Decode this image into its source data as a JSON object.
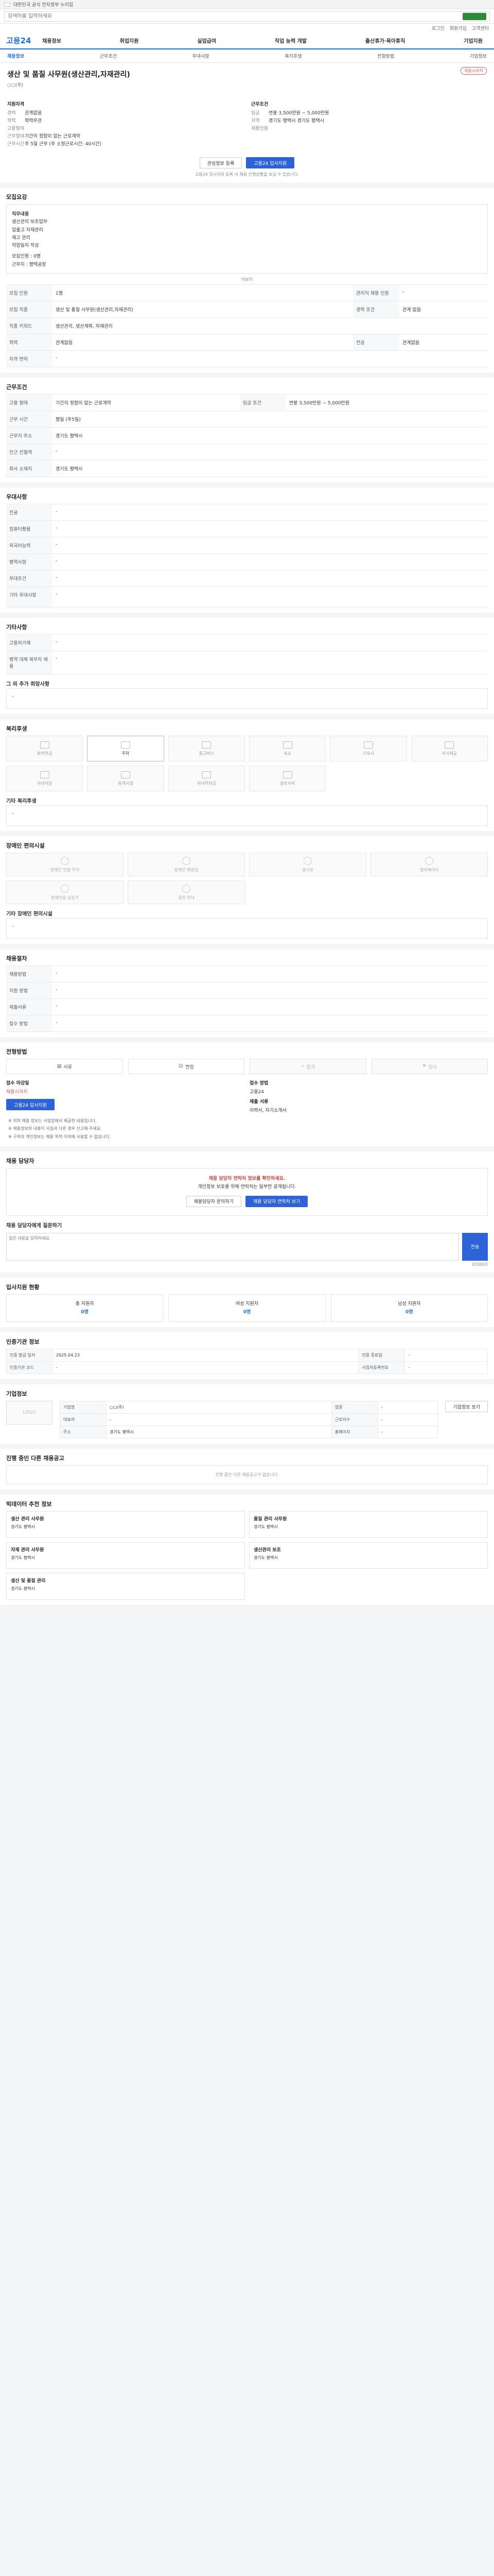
{
  "topstrip": {
    "text": "대한민국 공식 전자정부 누리집"
  },
  "search": {
    "placeholder": "검색어를 입력하세요"
  },
  "util": [
    "로그인",
    "회원가입",
    "고객센터"
  ],
  "gnb": {
    "logo": "고용24",
    "menu": [
      "채용정보",
      "취업지원",
      "실업급여",
      "직업 능력 개발",
      "출산휴가·육아휴직",
      "기업지원"
    ]
  },
  "tabs": [
    "채용정보",
    "근무조건",
    "우대사항",
    "복리후생",
    "전형방법",
    "기업정보"
  ],
  "job": {
    "title": "생산 및 품질 사무원(생산관리,자재관리)",
    "badge": "채용시까지",
    "org": "○○(주)"
  },
  "summary": {
    "left_title": "지원자격",
    "left": [
      {
        "k": "경력",
        "v": "관계없음"
      },
      {
        "k": "학력",
        "v": "학력무관"
      },
      {
        "k": "고용형태",
        "v": ""
      },
      {
        "k": "근무형태",
        "v": "기간의 정함이 없는 근로계약"
      },
      {
        "k": "근무시간",
        "v": "주 5일 근무 (주 소정근로시간: 40시간)"
      }
    ],
    "right_title": "근무조건",
    "right": [
      {
        "k": "임금",
        "v": "연봉 3,500만원 ~ 5,000만원"
      },
      {
        "k": "지역",
        "v": "경기도 평택시 경기도 평택시 "
      },
      {
        "k": "채용인원",
        "v": ""
      }
    ]
  },
  "buttons": {
    "scrap": "관심정보 등록",
    "apply": "고용24 입사지원"
  },
  "notice": "고용24 입사지원 등록 시 채용 진행상황을 보실 수 있습니다.",
  "overview": {
    "title": "모집요강",
    "work_title": "직무내용",
    "work": [
      "생산관리 보조업무",
      "입출고 자재관리",
      "재고 관리",
      "작업일지 작성"
    ],
    "req_label": "모집인원 : 0명",
    "req2": "근무지 : 평택공장",
    "more": "더보기"
  },
  "jobinfo": {
    "rows": [
      [
        "모집 인원",
        "1명",
        "관리직 채용 인원",
        "-"
      ],
      [
        "모집 직종",
        "생산 및 품질 사무원(생산관리,자재관리)",
        "경력 조건",
        "관계 없음"
      ],
      [
        "직종 키워드",
        "생산관리, 생산계획, 자재관리",
        "",
        ""
      ],
      [
        "학력",
        "관계없음",
        "전공",
        "관계없음"
      ],
      [
        "자격 면허",
        "-",
        "",
        ""
      ]
    ]
  },
  "cond": {
    "title": "근무조건",
    "rows": [
      [
        "고용 형태",
        "기간의 정함이 없는 근로계약",
        "임금 조건",
        "연봉 3,500만원 ~ 5,000만원"
      ],
      [
        "근무 시간",
        "평일 (주5일)",
        "",
        ""
      ],
      [
        "근무지 주소",
        "경기도 평택시",
        "",
        ""
      ],
      [
        "인근 전철역",
        "-",
        "",
        ""
      ],
      [
        "회사 소재지",
        "경기도 평택시",
        "",
        ""
      ]
    ]
  },
  "pref": {
    "title": "우대사항",
    "rows": [
      [
        "전공",
        "-"
      ],
      [
        "컴퓨터활용",
        "-"
      ],
      [
        "외국어능력",
        "-"
      ],
      [
        "병역사항",
        "-"
      ],
      [
        "우대조건",
        "-"
      ],
      [
        "기타 우대사항",
        "-"
      ]
    ]
  },
  "other": {
    "title": "기타사항",
    "rows": [
      [
        "고용허가제",
        "-"
      ],
      [
        "병역 대체 복무자 채용",
        "-"
      ]
    ],
    "extra": "그 외 추가 희망사항",
    "extra_v": "-"
  },
  "welfare": {
    "title": "복리후생",
    "items": [
      "퇴직연금",
      "주차",
      "통근버스",
      "숙소",
      "기숙사",
      "식사제공",
      "사내식당",
      "휴게시설",
      "자녀학자금",
      "경조사비"
    ],
    "on": [
      1
    ],
    "other_label": "기타 복리후생",
    "other_v": "-"
  },
  "disab": {
    "title": "장애인 편의시설",
    "items": [
      "장애인 전용 주차",
      "장애인 화장실",
      "경사로",
      "엘리베이터",
      "장애인용 승강기",
      "점자 안내"
    ],
    "other_label": "기타 장애인 편의시설",
    "other_v": "-"
  },
  "apply_method": {
    "title": "채용절차",
    "rows": [
      [
        "채용방법",
        "-"
      ],
      [
        "지원 방법",
        "-"
      ],
      [
        "제출서류",
        "-"
      ],
      [
        "접수 방법",
        "-"
      ]
    ]
  },
  "steps": {
    "title": "전형방법",
    "items": [
      "서류",
      "면접",
      "합격",
      "입사"
    ]
  },
  "apply_info": {
    "deadline_label": "접수 마감일",
    "deadline": "채용시까지",
    "method_label": "접수 방법",
    "method": "고용24",
    "doc_label": "제출 서류",
    "doc": "이력서, 자기소개서"
  },
  "bullets": [
    "※ 위의 채용 정보는 사업장에서 제공한 내용입니다.",
    "※ 채용정보의 내용이 사실과 다른 경우 신고해 주세요.",
    "※ 구직자 개인정보는 채용 목적 이외에 사용할 수 없습니다."
  ],
  "contact": {
    "title": "채용 담당자",
    "notice": "채용 담당자 연락처 정보를 확인하세요.",
    "desc": "개인정보 보호를 위해 연락처는 일부만 공개됩니다.",
    "btn1": "채용담당자 문의하기",
    "btn2": "채용 담당자 연락처 보기",
    "qtitle": "채용 담당자에게 질문하기",
    "qplaceholder": "질문 내용을 입력하세요.",
    "send": "전송",
    "count": "0/500자"
  },
  "stats": {
    "title": "입사지원 현황",
    "items": [
      {
        "k": "총 지원자",
        "v": "0명"
      },
      {
        "k": "여성 지원자",
        "v": "0명"
      },
      {
        "k": "남성 지원자",
        "v": "0명"
      }
    ]
  },
  "reginfo": {
    "title": "인증기관 정보",
    "rows": [
      [
        "인증 발급 일자",
        "2025.04.23",
        "인증 종료일",
        "-"
      ],
      [
        "인증기관 코드",
        "-",
        "사업자등록번호",
        "-"
      ]
    ]
  },
  "company": {
    "title": "기업정보",
    "logo": "LOGO",
    "rows": [
      [
        "기업명",
        "○○(주)",
        "업종",
        "-"
      ],
      [
        "대표자",
        "-",
        "근로자수",
        "-"
      ],
      [
        "주소",
        "경기도 평택시",
        "홈페이지",
        "-"
      ]
    ],
    "btn": "기업정보 보기"
  },
  "other_jobs": {
    "title": "진행 중인 다른 채용공고",
    "empty": "진행 중인 다른 채용공고가 없습니다."
  },
  "recommend": {
    "title": "빅데이터 추천 정보",
    "items": [
      {
        "tag": "",
        "title": "생산 관리 사무원",
        "sub": "경기도 평택시"
      },
      {
        "tag": "",
        "title": "품질 관리 사무원",
        "sub": "경기도 평택시"
      },
      {
        "tag": "",
        "title": "자재 관리 사무원",
        "sub": "경기도 평택시"
      },
      {
        "tag": "",
        "title": "생산관리 보조",
        "sub": "경기도 평택시"
      },
      {
        "tag": "",
        "title": "생산 및 품질 관리",
        "sub": "경기도 평택시"
      }
    ]
  }
}
